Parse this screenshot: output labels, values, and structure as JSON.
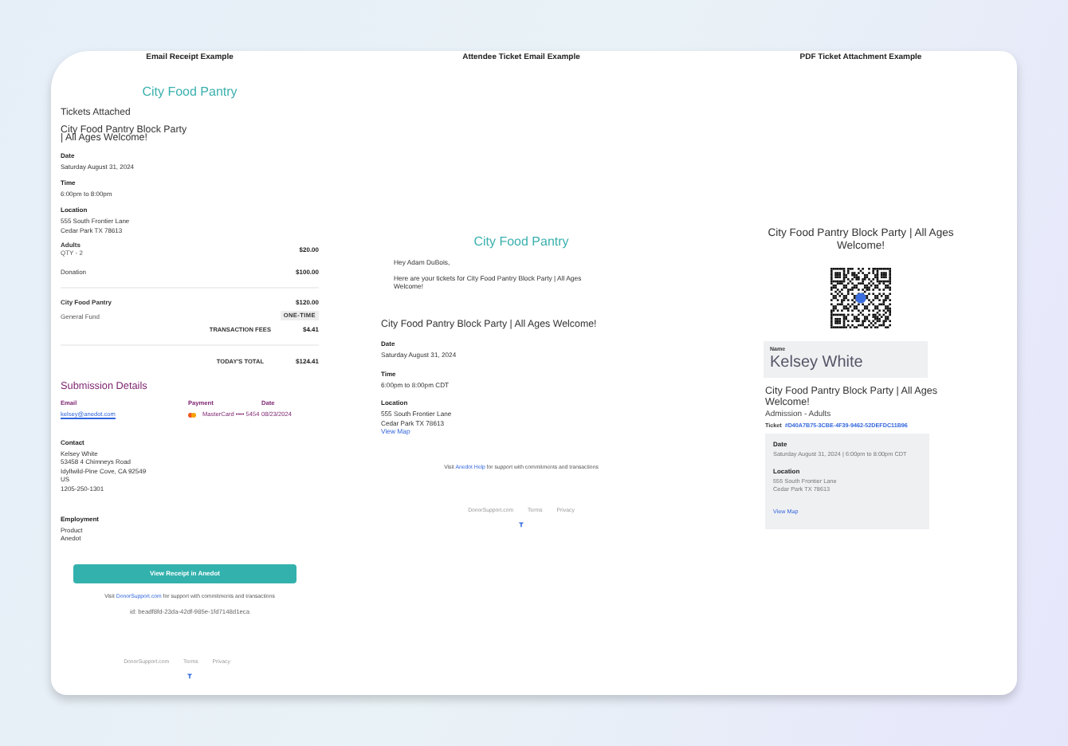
{
  "email_receipt": {
    "heading": "Email Receipt Example",
    "org": "City Food Pantry",
    "subtitle": "Tickets Attached",
    "event_title": "City Food Pantry Block Party\n| All Ages Welcome!",
    "details": [
      {
        "label": "Date",
        "lines": [
          "Saturday August 31, 2024"
        ]
      },
      {
        "label": "Time",
        "lines": [
          "6:00pm to 8:00pm"
        ]
      },
      {
        "label": "Location",
        "lines": [
          "555 South Frontier Lane",
          "Cedar Park TX 78613"
        ]
      }
    ],
    "line_items": [
      {
        "name": "Adults",
        "note": "QTY - 2",
        "amount": "$20.00"
      },
      {
        "name": "Donation",
        "amount": "$100.00"
      }
    ],
    "fund": {
      "name": "City Food Pantry",
      "amount": "$120.00",
      "fund": "General Fund",
      "frequency": "ONE-TIME"
    },
    "fees": {
      "label": "TRANSACTION FEES",
      "value": "$4.41"
    },
    "total": {
      "label": "TODAY'S TOTAL",
      "value": "$124.41"
    },
    "submission": {
      "title": "Submission Details",
      "fields": [
        {
          "kind": "email",
          "label": "Email",
          "value": "kelsey@anedot.com"
        },
        {
          "kind": "card",
          "label": "Payment",
          "value": "MasterCard •••• 5454"
        },
        {
          "kind": "text",
          "label": "Date",
          "value": "08/23/2024"
        }
      ]
    },
    "contact": {
      "label": "Contact",
      "lines": [
        "Kelsey White",
        "53458 4 Chimneys Road",
        "Idyllwild-Pine Cove, CA 92549",
        "US",
        "1205-250-1301"
      ]
    },
    "employment": {
      "label": "Employment",
      "lines": [
        "Product",
        "Anedot"
      ]
    },
    "button": "View Receipt in Anedot",
    "support": {
      "before": "Visit ",
      "link": "DonorSupport.com",
      "after": " for support with commitments and transactions"
    },
    "receipt_id": "id: beadf8fd-23da-42df-985e-1fd7148d1eca",
    "footer_links": [
      "DonorSupport.com",
      "Terms",
      "Privacy"
    ]
  },
  "attendee_email": {
    "heading": "Attendee Ticket Email Example",
    "org": "City Food Pantry",
    "greeting": "Hey Adam DuBois,",
    "message": "Here are your tickets for City Food Pantry Block Party | All Ages Welcome!",
    "event_title": "City Food Pantry Block Party | All Ages Welcome!",
    "details": [
      {
        "label": "Date",
        "lines": [
          "Saturday August 31, 2024"
        ]
      },
      {
        "label": "Time",
        "lines": [
          "6:00pm to 8:00pm CDT"
        ]
      },
      {
        "label": "Location",
        "lines": [
          "555 South Frontier Lane",
          "Cedar Park TX 78613"
        ],
        "link": "View Map"
      }
    ],
    "support": {
      "before": "Visit ",
      "link": "Anedot Help",
      "after": " for support with commitments and transactions"
    },
    "footer_links": [
      "DonorSupport.com",
      "Terms",
      "Privacy"
    ]
  },
  "pdf_ticket": {
    "heading": "PDF Ticket Attachment Example",
    "event_title": "City Food Pantry Block Party | All Ages Welcome!",
    "name_label": "Name",
    "name": "Kelsey White",
    "ticket_event": "City Food Pantry Block Party | All Ages Welcome!",
    "admission": "Admission - Adults",
    "ticket_label": "Ticket",
    "ticket_number": "#D40A7B75-3CBE-4F39-9462-52DEFDC11B96",
    "date_label": "Date",
    "date_value": "Saturday August 31, 2024 |  6:00pm to  8:00pm CDT",
    "location_label": "Location",
    "location_lines": [
      "555 South Frontier Lane",
      "Cedar Park TX  78613"
    ],
    "map_link": "View Map"
  }
}
